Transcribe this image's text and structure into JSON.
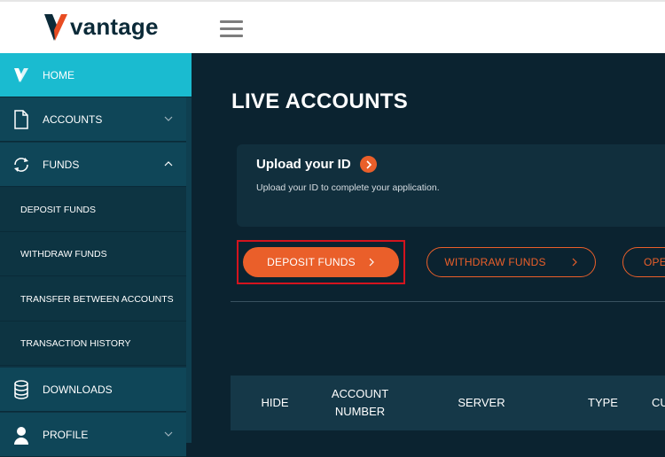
{
  "brand": {
    "name": "vantage",
    "accent": "#ea5f2a",
    "logo_colors": [
      "#e84c22",
      "#0b2a38"
    ]
  },
  "sidebar": {
    "items": [
      {
        "label": "HOME",
        "icon": "vantage-v-icon"
      },
      {
        "label": "ACCOUNTS",
        "icon": "document-icon"
      },
      {
        "label": "FUNDS",
        "icon": "refresh-arrows-icon"
      },
      {
        "label": "DEPOSIT FUNDS"
      },
      {
        "label": "WITHDRAW FUNDS"
      },
      {
        "label": "TRANSFER BETWEEN ACCOUNTS"
      },
      {
        "label": "TRANSACTION HISTORY"
      },
      {
        "label": "DOWNLOADS",
        "icon": "database-icon"
      },
      {
        "label": "PROFILE",
        "icon": "user-icon"
      }
    ]
  },
  "main": {
    "title": "LIVE ACCOUNTS",
    "upload_card": {
      "title": "Upload your ID",
      "subtitle": "Upload your ID to complete your application."
    },
    "buttons": {
      "deposit": "DEPOSIT FUNDS",
      "withdraw": "WITHDRAW FUNDS",
      "open": "OPE"
    },
    "table": {
      "headers": [
        "HIDE",
        "ACCOUNT NUMBER",
        "SERVER",
        "TYPE",
        "CU"
      ]
    }
  }
}
